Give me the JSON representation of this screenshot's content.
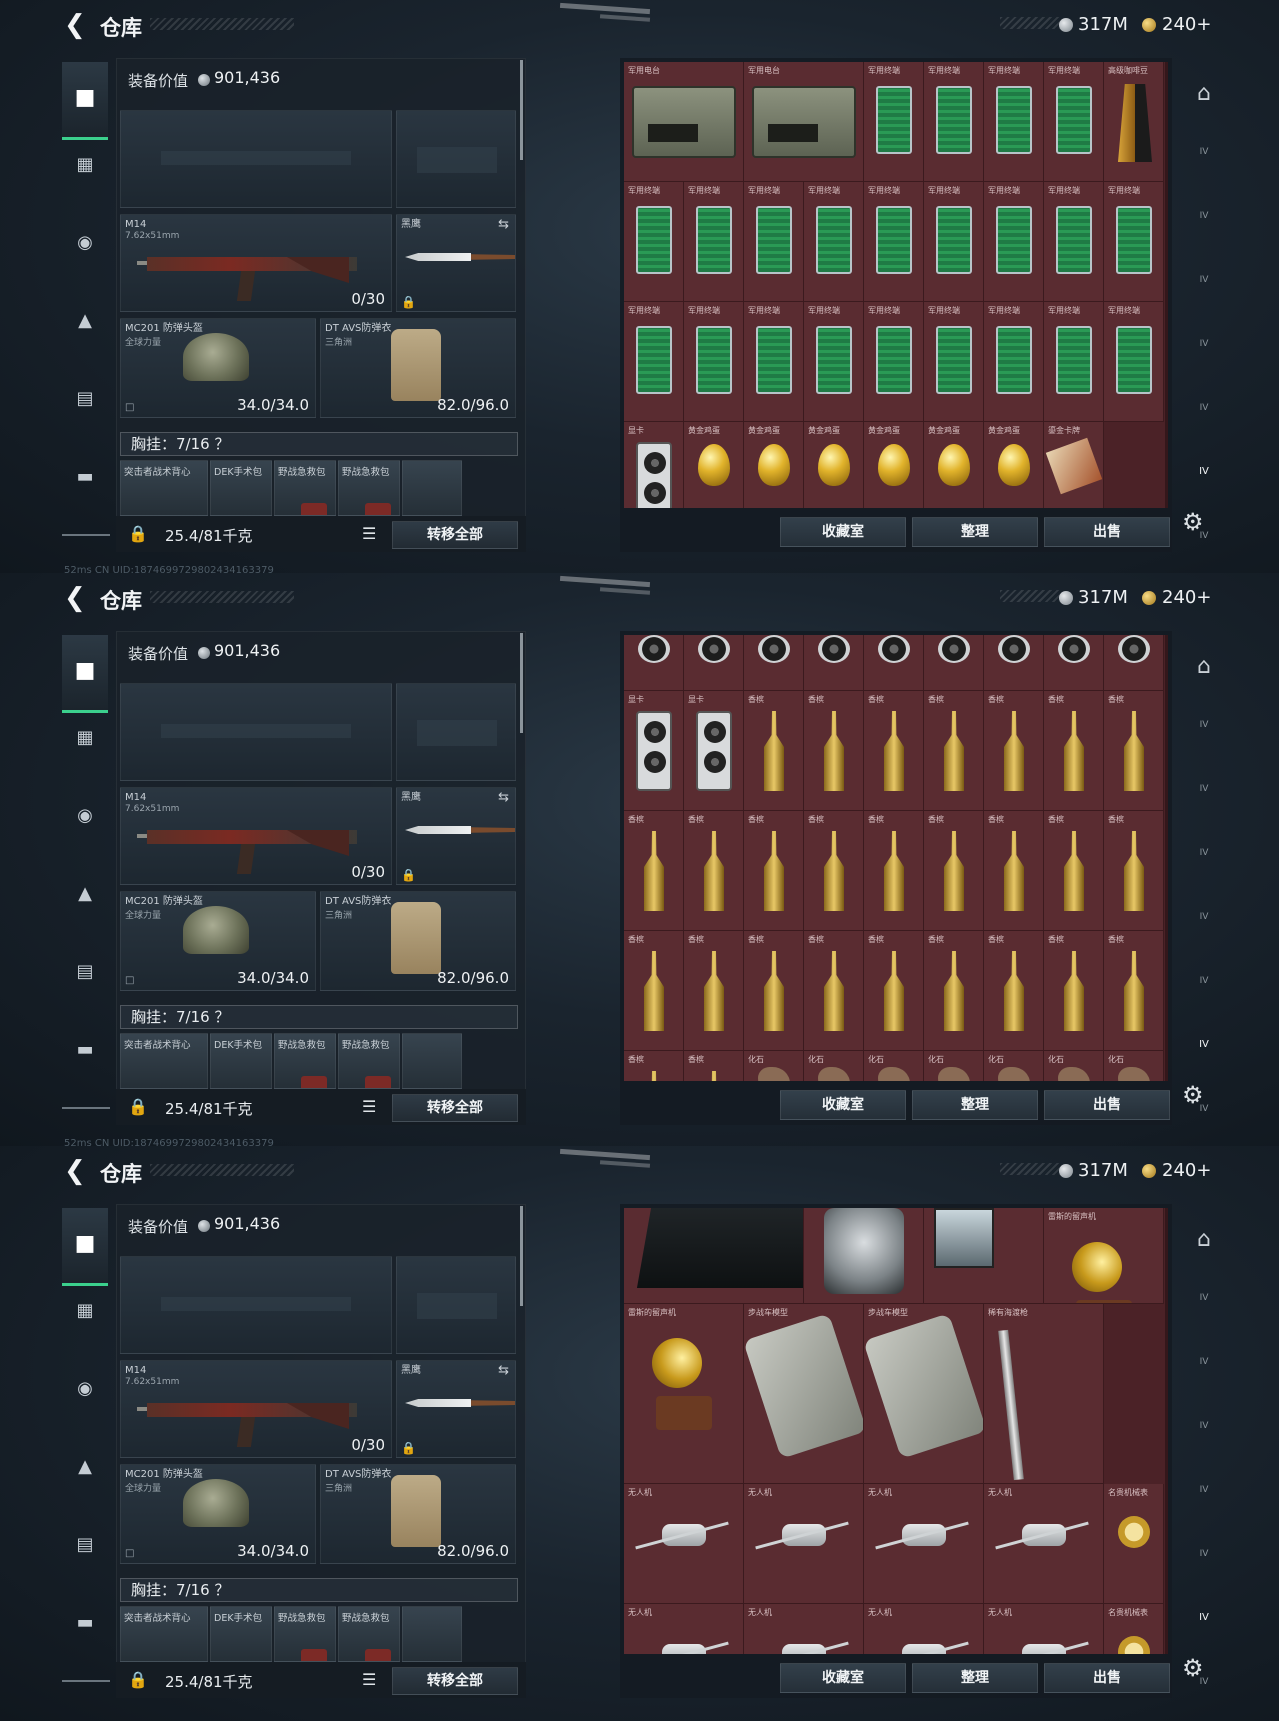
{
  "shots": [
    {
      "header": {
        "title": "仓库",
        "silver": "317M",
        "gold": "240+"
      },
      "loadout": {
        "equip_value_label": "装备价值",
        "equip_value": "901,436",
        "primary": {
          "name": "M14",
          "caliber": "7.62x51mm",
          "ammo": "0/30"
        },
        "melee": {
          "name": "黑鹰"
        },
        "helmet": {
          "name": "MC201 防弹头盔",
          "sub": "全球力量",
          "durability": "34.0/34.0"
        },
        "armor": {
          "name": "DT AVS防弹衣",
          "sub": "三角洲",
          "durability": "82.0/96.0"
        },
        "chest_rig": "胸挂：7/16 ？",
        "pouches": [
          "突击者战术背心",
          "DEK手术包",
          "野战急救包",
          "野战急救包"
        ],
        "weight": "25.4/81千克",
        "transfer_all": "转移全部"
      },
      "stash": {
        "buttons": [
          "收藏室",
          "整理",
          "出售"
        ],
        "items": [
          {
            "label": "军用电台",
            "kind": "radio"
          },
          {
            "label": "军用电台",
            "kind": "radio"
          },
          {
            "label": "军用终端",
            "kind": "board"
          },
          {
            "label": "军用终端",
            "kind": "board"
          },
          {
            "label": "军用终端",
            "kind": "board"
          },
          {
            "label": "军用终端",
            "kind": "board"
          },
          {
            "label": "高级咖啡豆",
            "kind": "coffee"
          },
          {
            "label": "军用终端",
            "kind": "board"
          },
          {
            "label": "军用终端",
            "kind": "board"
          },
          {
            "label": "军用终端",
            "kind": "board"
          },
          {
            "label": "军用终端",
            "kind": "board"
          },
          {
            "label": "军用终端",
            "kind": "board"
          },
          {
            "label": "军用终端",
            "kind": "board"
          },
          {
            "label": "军用终端",
            "kind": "board"
          },
          {
            "label": "军用终端",
            "kind": "board"
          },
          {
            "label": "军用终端",
            "kind": "board"
          },
          {
            "label": "军用终端",
            "kind": "board"
          },
          {
            "label": "军用终端",
            "kind": "board"
          },
          {
            "label": "军用终端",
            "kind": "board"
          },
          {
            "label": "军用终端",
            "kind": "board"
          },
          {
            "label": "军用终端",
            "kind": "board"
          },
          {
            "label": "军用终端",
            "kind": "board"
          },
          {
            "label": "军用终端",
            "kind": "board"
          },
          {
            "label": "军用终端",
            "kind": "board"
          },
          {
            "label": "军用终端",
            "kind": "board"
          },
          {
            "label": "显卡",
            "kind": "gpu"
          },
          {
            "label": "黄金鸡蛋",
            "kind": "egg"
          },
          {
            "label": "黄金鸡蛋",
            "kind": "egg"
          },
          {
            "label": "黄金鸡蛋",
            "kind": "egg"
          },
          {
            "label": "黄金鸡蛋",
            "kind": "egg"
          },
          {
            "label": "黄金鸡蛋",
            "kind": "egg"
          },
          {
            "label": "黄金鸡蛋",
            "kind": "egg"
          },
          {
            "label": "鎏金卡牌",
            "kind": "card"
          }
        ]
      },
      "status": "52ms    CN UID:1874699729802434163379"
    },
    {
      "header": {
        "title": "仓库",
        "silver": "317M",
        "gold": "240+"
      },
      "loadout": {
        "equip_value_label": "装备价值",
        "equip_value": "901,436",
        "primary": {
          "name": "M14",
          "caliber": "7.62x51mm",
          "ammo": "0/30"
        },
        "melee": {
          "name": "黑鹰"
        },
        "helmet": {
          "name": "MC201 防弹头盔",
          "sub": "全球力量",
          "durability": "34.0/34.0"
        },
        "armor": {
          "name": "DT AVS防弹衣",
          "sub": "三角洲",
          "durability": "82.0/96.0"
        },
        "chest_rig": "胸挂：7/16 ？",
        "pouches": [
          "突击者战术背心",
          "DEK手术包",
          "野战急救包",
          "野战急救包"
        ],
        "weight": "25.4/81千克",
        "transfer_all": "转移全部"
      },
      "stash": {
        "buttons": [
          "收藏室",
          "整理",
          "出售"
        ],
        "items": [
          {
            "label": "",
            "kind": "gpu-top"
          },
          {
            "label": "",
            "kind": "gpu-top"
          },
          {
            "label": "",
            "kind": "gpu-top"
          },
          {
            "label": "",
            "kind": "gpu-top"
          },
          {
            "label": "",
            "kind": "gpu-top"
          },
          {
            "label": "",
            "kind": "gpu-top"
          },
          {
            "label": "",
            "kind": "gpu-top"
          },
          {
            "label": "",
            "kind": "gpu-top"
          },
          {
            "label": "",
            "kind": "gpu-top"
          },
          {
            "label": "显卡",
            "kind": "gpu"
          },
          {
            "label": "显卡",
            "kind": "gpu"
          },
          {
            "label": "香槟",
            "kind": "bottle"
          },
          {
            "label": "香槟",
            "kind": "bottle"
          },
          {
            "label": "香槟",
            "kind": "bottle"
          },
          {
            "label": "香槟",
            "kind": "bottle"
          },
          {
            "label": "香槟",
            "kind": "bottle"
          },
          {
            "label": "香槟",
            "kind": "bottle"
          },
          {
            "label": "香槟",
            "kind": "bottle"
          },
          {
            "label": "香槟",
            "kind": "bottle"
          },
          {
            "label": "香槟",
            "kind": "bottle"
          },
          {
            "label": "香槟",
            "kind": "bottle"
          },
          {
            "label": "香槟",
            "kind": "bottle"
          },
          {
            "label": "香槟",
            "kind": "bottle"
          },
          {
            "label": "香槟",
            "kind": "bottle"
          },
          {
            "label": "香槟",
            "kind": "bottle"
          },
          {
            "label": "香槟",
            "kind": "bottle"
          },
          {
            "label": "香槟",
            "kind": "bottle"
          },
          {
            "label": "香槟",
            "kind": "bottle"
          },
          {
            "label": "香槟",
            "kind": "bottle"
          },
          {
            "label": "香槟",
            "kind": "bottle"
          },
          {
            "label": "香槟",
            "kind": "bottle"
          },
          {
            "label": "香槟",
            "kind": "bottle"
          },
          {
            "label": "香槟",
            "kind": "bottle"
          },
          {
            "label": "香槟",
            "kind": "bottle"
          },
          {
            "label": "香槟",
            "kind": "bottle"
          },
          {
            "label": "香槟",
            "kind": "bottle"
          },
          {
            "label": "香槟",
            "kind": "bottle"
          },
          {
            "label": "香槟",
            "kind": "bottle"
          },
          {
            "label": "化石",
            "kind": "fossil"
          },
          {
            "label": "化石",
            "kind": "fossil"
          },
          {
            "label": "化石",
            "kind": "fossil"
          },
          {
            "label": "化石",
            "kind": "fossil"
          },
          {
            "label": "化石",
            "kind": "fossil"
          },
          {
            "label": "化石",
            "kind": "fossil"
          },
          {
            "label": "化石",
            "kind": "fossil"
          }
        ]
      },
      "status": "52ms    CN UID:1874699729802434163379"
    },
    {
      "header": {
        "title": "仓库",
        "silver": "317M",
        "gold": "240+"
      },
      "loadout": {
        "equip_value_label": "装备价值",
        "equip_value": "901,436",
        "primary": {
          "name": "M14",
          "caliber": "7.62x51mm",
          "ammo": "0/30"
        },
        "melee": {
          "name": "黑鹰"
        },
        "helmet": {
          "name": "MC201 防弹头盔",
          "sub": "全球力量",
          "durability": "34.0/34.0"
        },
        "armor": {
          "name": "DT AVS防弹衣",
          "sub": "三角洲",
          "durability": "82.0/96.0"
        },
        "chest_rig": "胸挂：7/16 ？",
        "pouches": [
          "突击者战术背心",
          "DEK手术包",
          "野战急救包",
          "野战急救包"
        ],
        "weight": "25.4/81千克",
        "transfer_all": "转移全部"
      },
      "stash": {
        "buttons": [
          "收藏室",
          "整理",
          "出售"
        ],
        "items": [
          {
            "label": "",
            "kind": "crate"
          },
          {
            "label": "",
            "kind": "machine"
          },
          {
            "label": "",
            "kind": "vending"
          },
          {
            "label": "雷斯的留声机",
            "kind": "gramophone"
          },
          {
            "label": "雷斯的留声机",
            "kind": "gramophone"
          },
          {
            "label": "步战车模型",
            "kind": "apc"
          },
          {
            "label": "步战车模型",
            "kind": "apc"
          },
          {
            "label": "稀有海渡枪",
            "kind": "sword"
          },
          {
            "label": "无人机",
            "kind": "drone"
          },
          {
            "label": "无人机",
            "kind": "drone"
          },
          {
            "label": "无人机",
            "kind": "drone"
          },
          {
            "label": "无人机",
            "kind": "drone"
          },
          {
            "label": "名贵机械表",
            "kind": "watch"
          },
          {
            "label": "无人机",
            "kind": "drone"
          },
          {
            "label": "无人机",
            "kind": "drone"
          },
          {
            "label": "无人机",
            "kind": "drone"
          },
          {
            "label": "无人机",
            "kind": "drone"
          },
          {
            "label": "名贵机械表",
            "kind": "watch"
          }
        ]
      },
      "status": ""
    }
  ],
  "right_nav": [
    "home-icon",
    "IV",
    "IV",
    "IV",
    "IV",
    "IV",
    "IV",
    "IV"
  ],
  "left_nav": [
    "pistol-icon",
    "vest-icon",
    "armor-icon",
    "backpack-icon",
    "container-icon",
    "briefcase-icon"
  ],
  "colors": {
    "accent": "#3bd08d",
    "stash_bg": "#4b2227"
  }
}
